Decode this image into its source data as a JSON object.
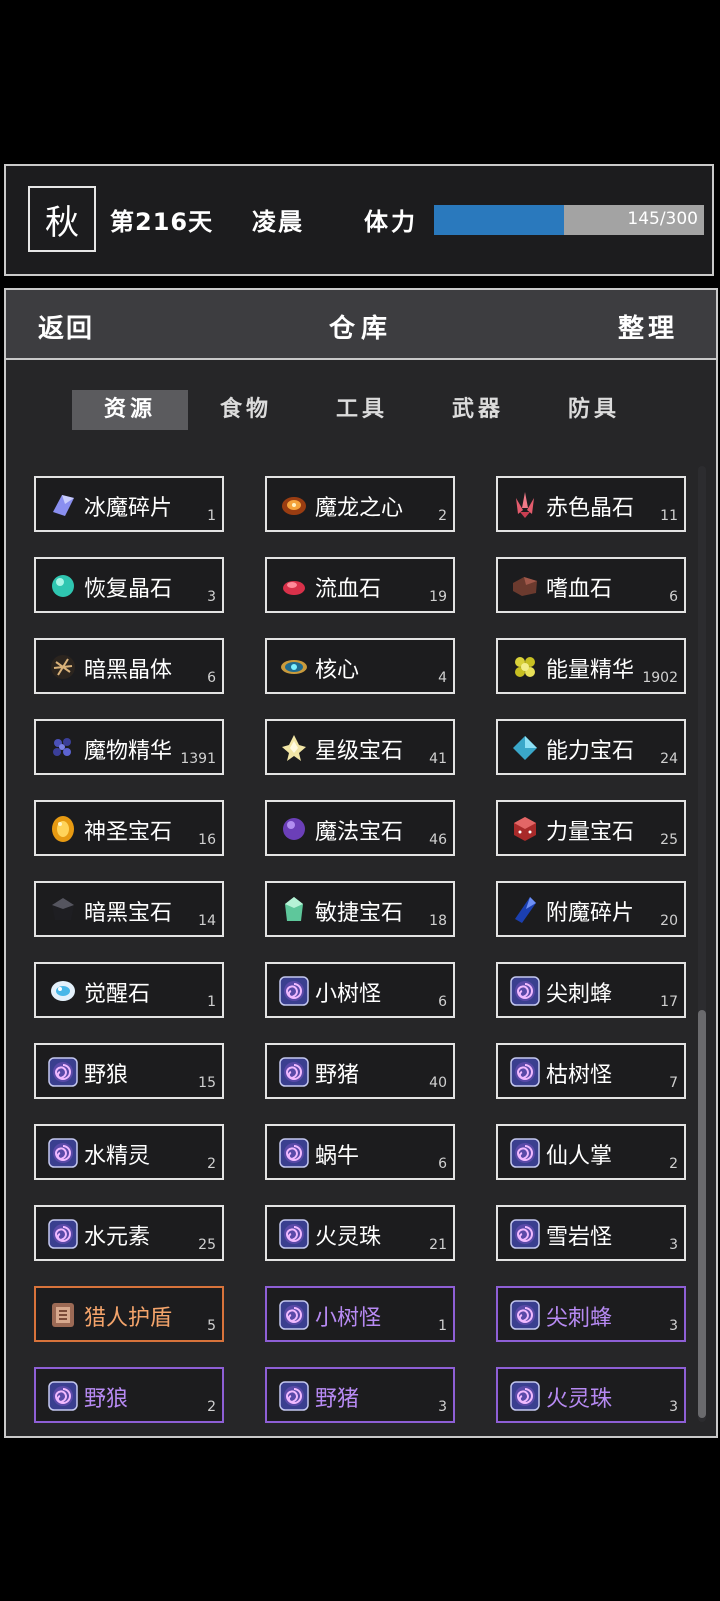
{
  "status": {
    "season": "秋",
    "day": "第216天",
    "time": "凌晨",
    "stamina_label": "体力",
    "stamina_text": "145/300",
    "stamina_fraction": 0.483
  },
  "header": {
    "back": "返回",
    "title": "仓库",
    "sort": "整理"
  },
  "tabs": [
    "资源",
    "食物",
    "工具",
    "武器",
    "防具"
  ],
  "active_tab": 0,
  "items": [
    {
      "name": "冰魔碎片",
      "count": "1",
      "icon": "ice-crystal-icon",
      "style": "normal"
    },
    {
      "name": "魔龙之心",
      "count": "2",
      "icon": "dragon-heart-icon",
      "style": "normal"
    },
    {
      "name": "赤色晶石",
      "count": "11",
      "icon": "red-crystal-icon",
      "style": "normal"
    },
    {
      "name": "恢复晶石",
      "count": "3",
      "icon": "cyan-gem-icon",
      "style": "normal"
    },
    {
      "name": "流血石",
      "count": "19",
      "icon": "red-stone-icon",
      "style": "normal"
    },
    {
      "name": "嗜血石",
      "count": "6",
      "icon": "brown-stone-icon",
      "style": "normal"
    },
    {
      "name": "暗黑晶体",
      "count": "6",
      "icon": "dark-crystal-icon",
      "style": "normal"
    },
    {
      "name": "核心",
      "count": "4",
      "icon": "eye-core-icon",
      "style": "normal"
    },
    {
      "name": "能量精华",
      "count": "1902",
      "icon": "energy-orbs-icon",
      "style": "normal"
    },
    {
      "name": "魔物精华",
      "count": "1391",
      "icon": "monster-essence-icon",
      "style": "normal"
    },
    {
      "name": "星级宝石",
      "count": "41",
      "icon": "star-gem-icon",
      "style": "normal"
    },
    {
      "name": "能力宝石",
      "count": "24",
      "icon": "ability-gem-icon",
      "style": "normal"
    },
    {
      "name": "神圣宝石",
      "count": "16",
      "icon": "holy-gem-icon",
      "style": "normal"
    },
    {
      "name": "魔法宝石",
      "count": "46",
      "icon": "magic-gem-icon",
      "style": "normal"
    },
    {
      "name": "力量宝石",
      "count": "25",
      "icon": "power-gem-icon",
      "style": "normal"
    },
    {
      "name": "暗黑宝石",
      "count": "14",
      "icon": "dark-gem-icon",
      "style": "normal"
    },
    {
      "name": "敏捷宝石",
      "count": "18",
      "icon": "agility-gem-icon",
      "style": "normal"
    },
    {
      "name": "附魔碎片",
      "count": "20",
      "icon": "enchant-shard-icon",
      "style": "normal"
    },
    {
      "name": "觉醒石",
      "count": "1",
      "icon": "awakening-stone-icon",
      "style": "normal"
    },
    {
      "name": "小树怪",
      "count": "6",
      "icon": "vortex-icon",
      "style": "normal"
    },
    {
      "name": "尖刺蜂",
      "count": "17",
      "icon": "vortex-icon",
      "style": "normal"
    },
    {
      "name": "野狼",
      "count": "15",
      "icon": "vortex-icon",
      "style": "normal"
    },
    {
      "name": "野猪",
      "count": "40",
      "icon": "vortex-icon",
      "style": "normal"
    },
    {
      "name": "枯树怪",
      "count": "7",
      "icon": "vortex-icon",
      "style": "normal"
    },
    {
      "name": "水精灵",
      "count": "2",
      "icon": "vortex-icon",
      "style": "normal"
    },
    {
      "name": "蜗牛",
      "count": "6",
      "icon": "vortex-icon",
      "style": "normal"
    },
    {
      "name": "仙人掌",
      "count": "2",
      "icon": "vortex-icon",
      "style": "normal"
    },
    {
      "name": "水元素",
      "count": "25",
      "icon": "vortex-icon",
      "style": "normal"
    },
    {
      "name": "火灵珠",
      "count": "21",
      "icon": "vortex-icon",
      "style": "normal"
    },
    {
      "name": "雪岩怪",
      "count": "3",
      "icon": "vortex-icon",
      "style": "normal"
    },
    {
      "name": "猎人护盾",
      "count": "5",
      "icon": "shield-icon",
      "style": "orange"
    },
    {
      "name": "小树怪",
      "count": "1",
      "icon": "vortex-icon",
      "style": "purple"
    },
    {
      "name": "尖刺蜂",
      "count": "3",
      "icon": "vortex-icon",
      "style": "purple"
    },
    {
      "name": "野狼",
      "count": "2",
      "icon": "vortex-icon",
      "style": "purple"
    },
    {
      "name": "野猪",
      "count": "3",
      "icon": "vortex-icon",
      "style": "purple"
    },
    {
      "name": "火灵珠",
      "count": "3",
      "icon": "vortex-icon",
      "style": "purple"
    }
  ],
  "colors": {
    "stamina_fill": "#2a79bd",
    "orange_rarity": "#d8733b",
    "purple_rarity": "#8e5fd6"
  }
}
